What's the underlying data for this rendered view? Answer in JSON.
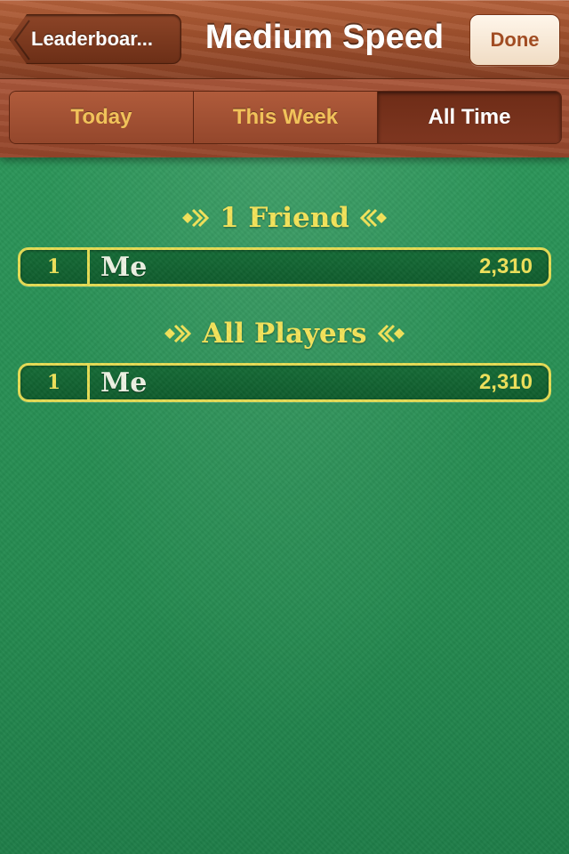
{
  "nav": {
    "back_label": "Leaderboar...",
    "title": "Medium Speed",
    "done_label": "Done"
  },
  "tabs": [
    {
      "label": "Today",
      "selected": false
    },
    {
      "label": "This Week",
      "selected": false
    },
    {
      "label": "All Time",
      "selected": true
    }
  ],
  "sections": [
    {
      "title": "1 Friend",
      "rows": [
        {
          "rank": "1",
          "player": "Me",
          "score": "2,310"
        }
      ]
    },
    {
      "title": "All Players",
      "rows": [
        {
          "rank": "1",
          "player": "Me",
          "score": "2,310"
        }
      ]
    }
  ],
  "colors": {
    "felt_green": "#2a9257",
    "wood_brown": "#9d4f2c",
    "accent_yellow": "#f4e45a",
    "row_green": "#156b36"
  }
}
